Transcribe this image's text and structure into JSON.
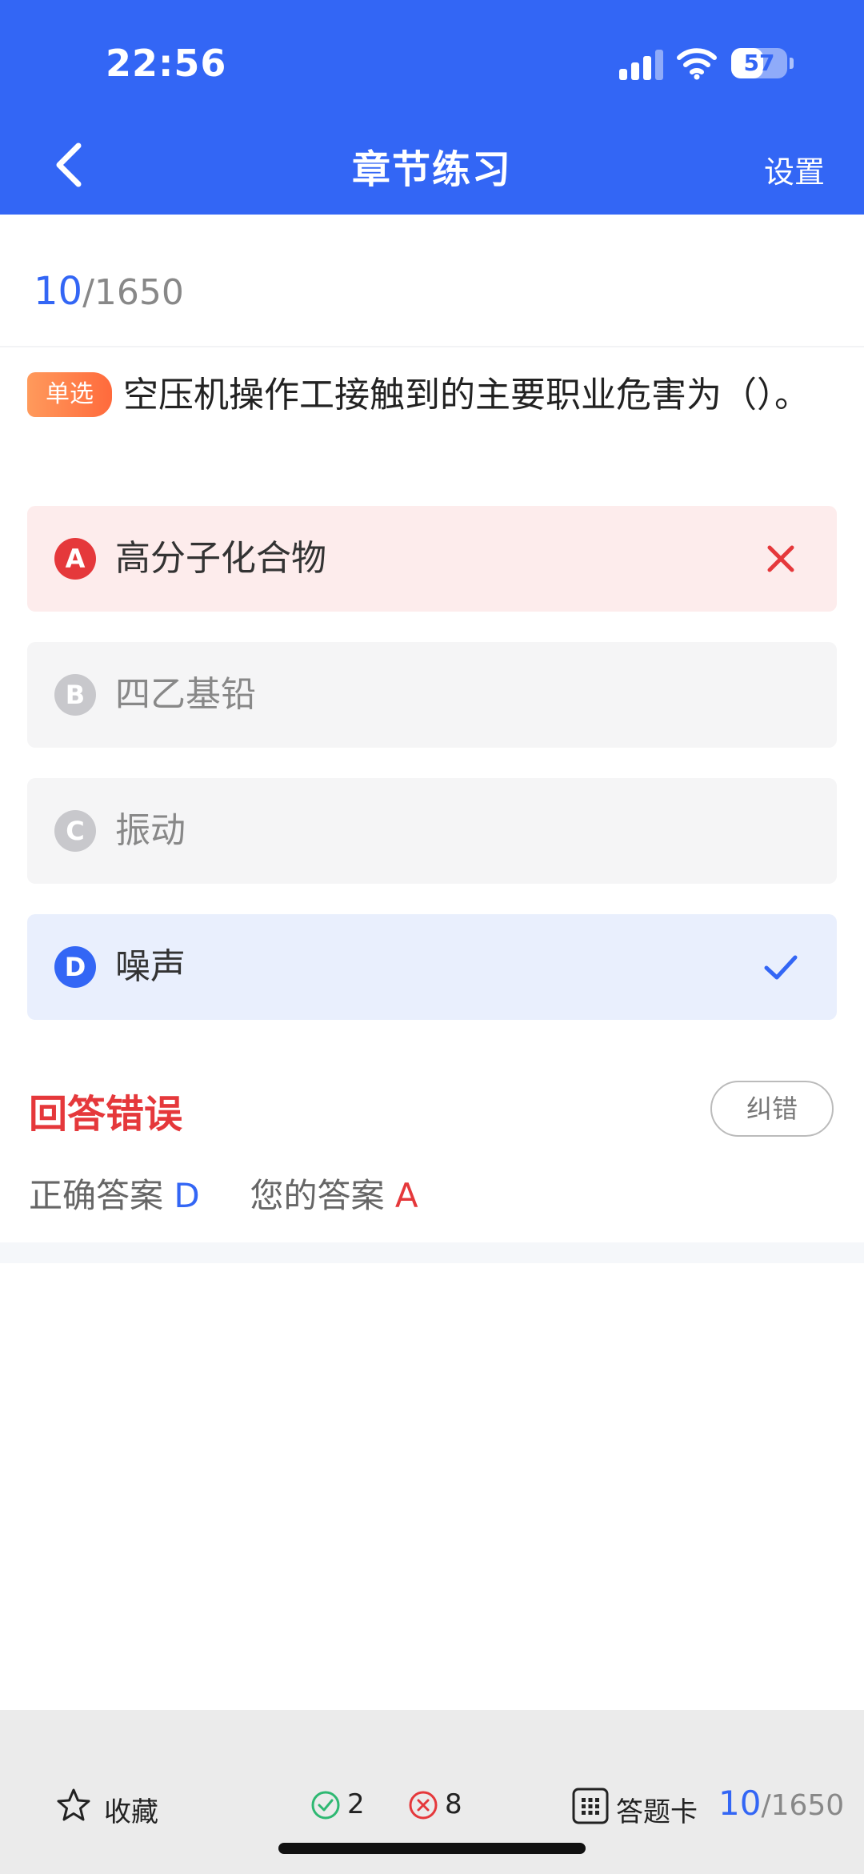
{
  "status_bar": {
    "time": "22:56",
    "battery": "57",
    "battery_level": 0.57
  },
  "nav": {
    "title": "章节练习",
    "settings_label": "设置",
    "back_icon": "chevron-left-icon"
  },
  "progress": {
    "current": "10",
    "total": "/1650"
  },
  "question": {
    "type_badge": "单选",
    "text": "空压机操作工接触到的主要职业危害为（）。"
  },
  "options": [
    {
      "letter": "A",
      "label": "高分子化合物",
      "state": "wrong",
      "mark_icon": "cross-icon"
    },
    {
      "letter": "B",
      "label": "四乙基铅",
      "state": "neutral"
    },
    {
      "letter": "C",
      "label": "振动",
      "state": "neutral"
    },
    {
      "letter": "D",
      "label": "噪声",
      "state": "correct",
      "mark_icon": "check-icon"
    }
  ],
  "result": {
    "title": "回答错误",
    "report_label": "纠错",
    "correct_label": "正确答案",
    "correct_value": "D",
    "your_label": "您的答案",
    "your_value": "A"
  },
  "bottom_bar": {
    "favorite_label": "收藏",
    "right_count": "2",
    "wrong_count": "8",
    "answer_card_label": "答题卡",
    "current": "10",
    "total": "/1650"
  },
  "colors": {
    "primary": "#3366F5",
    "error": "#E5383B",
    "correct": "#3366F5",
    "badge": "#FF7A45"
  }
}
